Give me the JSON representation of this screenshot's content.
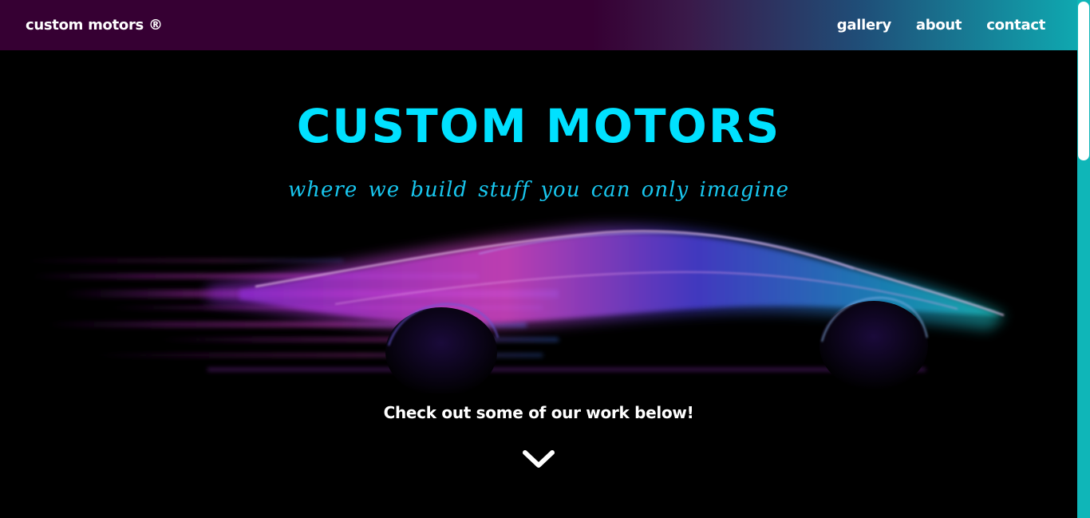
{
  "navbar": {
    "brand": "custom motors ®",
    "links": [
      "gallery",
      "about",
      "contact"
    ]
  },
  "hero": {
    "title": "CUSTOM MOTORS",
    "tagline": "where we build stuff you can only imagine",
    "cta": "Check out some of our work below!",
    "scroll_icon": "chevron-down-icon"
  },
  "colors": {
    "accent": "#00e1ff",
    "nav_start": "#360033",
    "nav_end": "#0fa8b0",
    "background": "#000000",
    "scrollbar": "#0fb6b8"
  }
}
